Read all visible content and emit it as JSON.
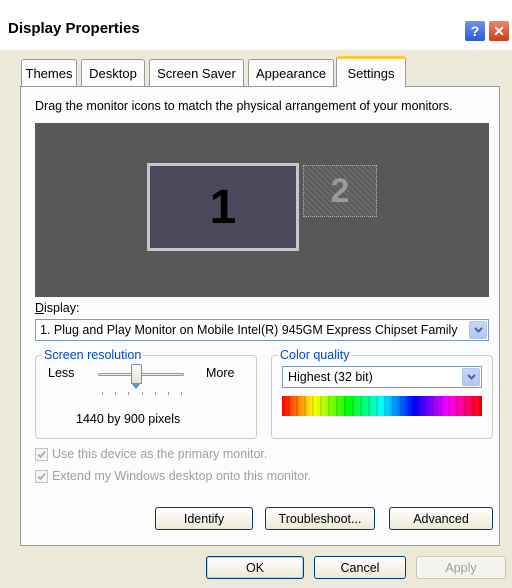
{
  "window": {
    "title": "Display Properties",
    "help_glyph": "?",
    "close_glyph": "✕"
  },
  "tabs": [
    {
      "label": "Themes"
    },
    {
      "label": "Desktop"
    },
    {
      "label": "Screen Saver"
    },
    {
      "label": "Appearance"
    },
    {
      "label": "Settings",
      "active": true
    }
  ],
  "settings": {
    "instruction": "Drag the monitor icons to match the physical arrangement of your monitors.",
    "monitor1_label": "1",
    "monitor2_label": "2",
    "display_label": "Display:",
    "display_value": "1. Plug and Play Monitor on Mobile Intel(R) 945GM Express Chipset Family",
    "screen_resolution": {
      "legend": "Screen resolution",
      "less_label": "Less",
      "more_label": "More",
      "value": "1440 by 900 pixels",
      "slider_position_fraction": 0.45
    },
    "color_quality": {
      "legend": "Color quality",
      "value": "Highest (32 bit)"
    },
    "primary_monitor_label": "Use this device as the primary monitor.",
    "extend_desktop_label": "Extend my Windows desktop onto this monitor.",
    "identify_label": "Identify",
    "troubleshoot_label": "Troubleshoot...",
    "advanced_label": "Advanced"
  },
  "footer": {
    "ok_label": "OK",
    "cancel_label": "Cancel",
    "apply_label": "Apply"
  },
  "colors": {
    "tab_highlight": "#ffc83c",
    "legend_blue": "#0046d5",
    "monitor_area": "#58585a"
  }
}
